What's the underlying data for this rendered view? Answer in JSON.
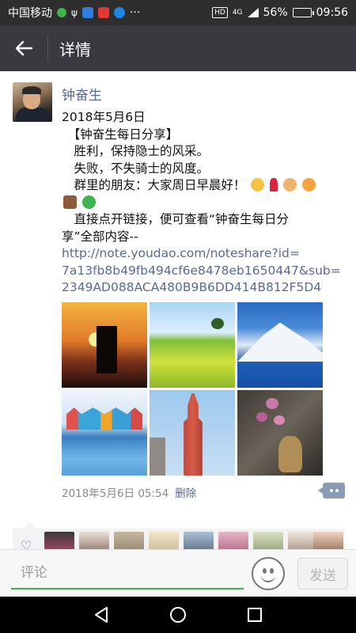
{
  "status_bar": {
    "carrier": "中国移动",
    "network": "4G",
    "battery_percent": "56%",
    "battery_level": 0.56,
    "time": "09:56",
    "hd_label": "HD",
    "more_label": "···"
  },
  "header": {
    "title": "详情"
  },
  "post": {
    "username": "钟奋生",
    "lines": [
      "2018年5月6日",
      "　【钟奋生每日分享】",
      "　胜利，保持隐士的风采。",
      "　失败，不失骑士的风度。",
      "　群里的朋友：大家周日早晨好！"
    ],
    "text_after_emoji": "　直接点开链接，便可查看“钟奋生每日分",
    "text_after_emoji_2": "享”全部内容--",
    "link_lines": [
      "http://note.youdao.com/noteshare?id=",
      "7a13fb8b49fb494cf6e8478eb1650447&sub=",
      "2349AD088ACA480B9B6DD414B812F5D4"
    ],
    "photos": [
      "sunset-crane",
      "meadow",
      "snow-mountain",
      "harbor-houses",
      "red-church-tower",
      "orchid-vase"
    ],
    "timestamp": "2018年5月6日 05:54",
    "delete_label": "删除"
  },
  "likes": {
    "count_shown": 9
  },
  "comment_bar": {
    "placeholder": "评论",
    "send_label": "发送"
  },
  "colors": {
    "link": "#576b95",
    "title_bar": "#393a3f",
    "input_underline": "#3fb34f"
  }
}
